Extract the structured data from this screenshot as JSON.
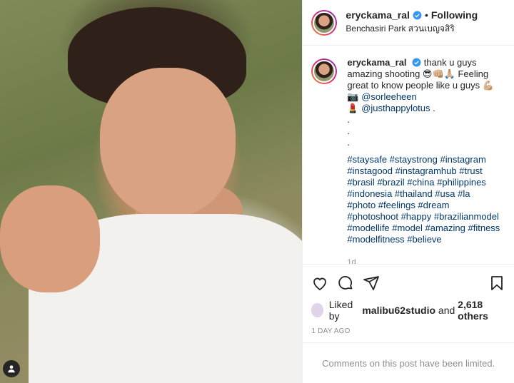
{
  "header": {
    "username": "eryckama_ral",
    "separator": "•",
    "follow_label": "Following",
    "location": "Benchasiri Park สวนเบญจสิริ"
  },
  "caption": {
    "username": "eryckama_ral",
    "line1": "thank u guys amazing shooting 😎👊🏼🙏🏼 Feeling great to know people like u guys 💪🏼",
    "camera_emoji": "📷",
    "tag1": "@sorleeheen",
    "lips_emoji": "💄",
    "tag2": "@justhappylotus",
    "tag2_suffix": " .",
    "dots": [
      ".",
      ".",
      "."
    ],
    "hashtags": "#staysafe #staystrong #instagram #instagood #instagramhub #trust #brasil #brazil #china #philippines #indonesia #thailand #usa #la #photo #feelings #dream #photoshoot #happy #brazilianmodel #modellife #model #amazing #fitness #modelfitness #believe",
    "age": "1d"
  },
  "likes": {
    "prefix": "Liked by",
    "liker": "malibu62studio",
    "and": "and",
    "others": "2,618 others"
  },
  "posted": "1 DAY AGO",
  "limited_notice": "Comments on this post have been limited.",
  "icons": [
    "heart-icon",
    "comment-icon",
    "share-icon",
    "bookmark-icon",
    "verified-icon",
    "user-tag-icon"
  ],
  "colors": {
    "link": "#00376b",
    "muted": "#8e8e8e",
    "verified": "#3897f0"
  }
}
